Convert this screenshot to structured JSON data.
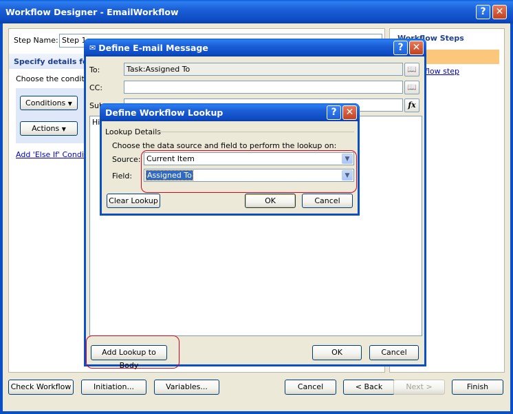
{
  "main_window": {
    "title": "Workflow Designer - EmailWorkflow",
    "step_name_label": "Step Name:",
    "step_name_value": "Step 1",
    "specify_details": "Specify details for",
    "choose_conditions": "Choose the condition",
    "conditions_button": "Conditions",
    "actions_button": "Actions",
    "add_else_if": "Add 'Else If' Conditio",
    "workflow_steps_header": "Workflow Steps",
    "workflow_steps_link": "flow step",
    "check_workflow": "Check Workflow",
    "initiation": "Initiation...",
    "variables": "Variables...",
    "cancel": "Cancel",
    "back": "< Back",
    "next": "Next >",
    "finish": "Finish"
  },
  "email_dialog": {
    "title": "Define E-mail Message",
    "to_label": "To:",
    "to_value": "Task:Assigned To",
    "cc_label": "CC:",
    "cc_value": "",
    "subject_label": "Sub",
    "body_text": "Hi",
    "add_lookup_button": "Add Lookup to Body",
    "ok": "OK",
    "cancel": "Cancel",
    "fx_icon": "fx"
  },
  "lookup_dialog": {
    "title": "Define Workflow Lookup",
    "group_label": "Lookup Details",
    "instructions": "Choose the data source and field to perform the lookup on:",
    "source_label": "Source:",
    "source_value": "Current Item",
    "field_label": "Field:",
    "field_value": "Assigned To",
    "clear_lookup": "Clear Lookup",
    "ok": "OK",
    "cancel": "Cancel"
  },
  "colors": {
    "xp_blue": "#0b4fc5",
    "panel_bg": "#ece9d8",
    "highlight_red": "#d9001c",
    "steps_highlight": "#fbc77c"
  }
}
